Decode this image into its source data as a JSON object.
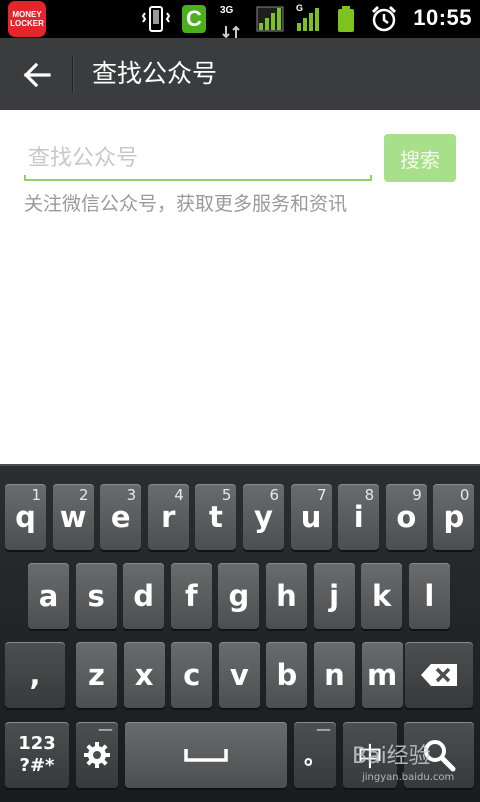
{
  "status_bar": {
    "app_badge_text": "MONEY LOCKER",
    "c_badge": "C",
    "net_3g": "3G",
    "net_g": "G",
    "time": "10:55"
  },
  "header": {
    "title": "查找公众号"
  },
  "search": {
    "placeholder": "查找公众号",
    "button_label": "搜索",
    "hint": "关注微信公众号，获取更多服务和资讯"
  },
  "keyboard": {
    "row1": [
      {
        "key": "q",
        "num": "1"
      },
      {
        "key": "w",
        "num": "2"
      },
      {
        "key": "e",
        "num": "3"
      },
      {
        "key": "r",
        "num": "4"
      },
      {
        "key": "t",
        "num": "5"
      },
      {
        "key": "y",
        "num": "6"
      },
      {
        "key": "u",
        "num": "7"
      },
      {
        "key": "i",
        "num": "8"
      },
      {
        "key": "o",
        "num": "9"
      },
      {
        "key": "p",
        "num": "0"
      }
    ],
    "row2": [
      "a",
      "s",
      "d",
      "f",
      "g",
      "h",
      "j",
      "k",
      "l"
    ],
    "row3": [
      ",",
      "z",
      "x",
      "c",
      "v",
      "b",
      "n",
      "m"
    ],
    "symbols_key": "123\n?#*",
    "period_key": "。",
    "ime_key": "中"
  },
  "watermark": {
    "text": "Bai经验",
    "url": "jingyan.baidu.com"
  }
}
